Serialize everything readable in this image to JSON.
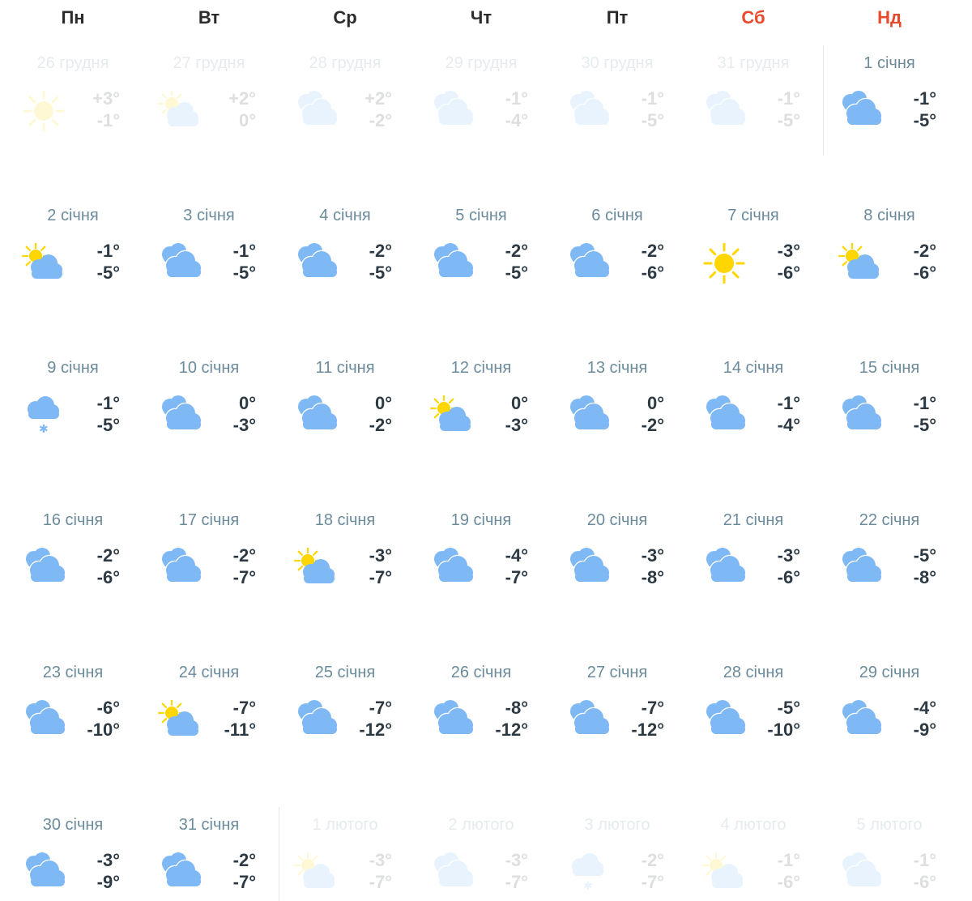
{
  "weekdays": [
    {
      "label": "Пн",
      "weekend": false
    },
    {
      "label": "Вт",
      "weekend": false
    },
    {
      "label": "Ср",
      "weekend": false
    },
    {
      "label": "Чт",
      "weekend": false
    },
    {
      "label": "Пт",
      "weekend": false
    },
    {
      "label": "Сб",
      "weekend": true
    },
    {
      "label": "Нд",
      "weekend": true
    }
  ],
  "colors": {
    "weekend": "#e8492d",
    "cloud": "#7eb8f5",
    "sun": "#ffd600",
    "date": "#6b8b9c",
    "temp": "#2d3a44"
  },
  "weeks": [
    [
      {
        "date": "26 грудня",
        "high": "+3°",
        "low": "-1°",
        "icon": "sun-icon",
        "faded": true
      },
      {
        "date": "27 грудня",
        "high": "+2°",
        "low": "0°",
        "icon": "partly-cloudy-icon",
        "faded": true
      },
      {
        "date": "28 грудня",
        "high": "+2°",
        "low": "-2°",
        "icon": "cloudy-icon",
        "faded": true
      },
      {
        "date": "29 грудня",
        "high": "-1°",
        "low": "-4°",
        "icon": "cloudy-icon",
        "faded": true
      },
      {
        "date": "30 грудня",
        "high": "-1°",
        "low": "-5°",
        "icon": "cloudy-icon",
        "faded": true
      },
      {
        "date": "31 грудня",
        "high": "-1°",
        "low": "-5°",
        "icon": "cloudy-icon",
        "faded": true
      },
      {
        "date": "1 січня",
        "high": "-1°",
        "low": "-5°",
        "icon": "cloudy-icon",
        "faded": false
      }
    ],
    [
      {
        "date": "2 січня",
        "high": "-1°",
        "low": "-5°",
        "icon": "partly-cloudy-icon",
        "faded": false
      },
      {
        "date": "3 січня",
        "high": "-1°",
        "low": "-5°",
        "icon": "cloudy-icon",
        "faded": false
      },
      {
        "date": "4 січня",
        "high": "-2°",
        "low": "-5°",
        "icon": "cloudy-icon",
        "faded": false
      },
      {
        "date": "5 січня",
        "high": "-2°",
        "low": "-5°",
        "icon": "cloudy-icon",
        "faded": false
      },
      {
        "date": "6 січня",
        "high": "-2°",
        "low": "-6°",
        "icon": "cloudy-icon",
        "faded": false
      },
      {
        "date": "7 січня",
        "high": "-3°",
        "low": "-6°",
        "icon": "sun-icon",
        "faded": false
      },
      {
        "date": "8 січня",
        "high": "-2°",
        "low": "-6°",
        "icon": "partly-cloudy-icon",
        "faded": false
      }
    ],
    [
      {
        "date": "9 січня",
        "high": "-1°",
        "low": "-5°",
        "icon": "snow-icon",
        "faded": false
      },
      {
        "date": "10 січня",
        "high": "0°",
        "low": "-3°",
        "icon": "cloudy-icon",
        "faded": false
      },
      {
        "date": "11 січня",
        "high": "0°",
        "low": "-2°",
        "icon": "cloudy-icon",
        "faded": false
      },
      {
        "date": "12 січня",
        "high": "0°",
        "low": "-3°",
        "icon": "partly-cloudy-icon",
        "faded": false
      },
      {
        "date": "13 січня",
        "high": "0°",
        "low": "-2°",
        "icon": "cloudy-icon",
        "faded": false
      },
      {
        "date": "14 січня",
        "high": "-1°",
        "low": "-4°",
        "icon": "cloudy-icon",
        "faded": false
      },
      {
        "date": "15 січня",
        "high": "-1°",
        "low": "-5°",
        "icon": "cloudy-icon",
        "faded": false
      }
    ],
    [
      {
        "date": "16 січня",
        "high": "-2°",
        "low": "-6°",
        "icon": "cloudy-icon",
        "faded": false
      },
      {
        "date": "17 січня",
        "high": "-2°",
        "low": "-7°",
        "icon": "cloudy-icon",
        "faded": false
      },
      {
        "date": "18 січня",
        "high": "-3°",
        "low": "-7°",
        "icon": "partly-cloudy-icon",
        "faded": false
      },
      {
        "date": "19 січня",
        "high": "-4°",
        "low": "-7°",
        "icon": "cloudy-icon",
        "faded": false
      },
      {
        "date": "20 січня",
        "high": "-3°",
        "low": "-8°",
        "icon": "cloudy-icon",
        "faded": false
      },
      {
        "date": "21 січня",
        "high": "-3°",
        "low": "-6°",
        "icon": "cloudy-icon",
        "faded": false
      },
      {
        "date": "22 січня",
        "high": "-5°",
        "low": "-8°",
        "icon": "cloudy-icon",
        "faded": false
      }
    ],
    [
      {
        "date": "23 січня",
        "high": "-6°",
        "low": "-10°",
        "icon": "cloudy-icon",
        "faded": false
      },
      {
        "date": "24 січня",
        "high": "-7°",
        "low": "-11°",
        "icon": "partly-cloudy-icon",
        "faded": false
      },
      {
        "date": "25 січня",
        "high": "-7°",
        "low": "-12°",
        "icon": "cloudy-icon",
        "faded": false
      },
      {
        "date": "26 січня",
        "high": "-8°",
        "low": "-12°",
        "icon": "cloudy-icon",
        "faded": false
      },
      {
        "date": "27 січня",
        "high": "-7°",
        "low": "-12°",
        "icon": "cloudy-icon",
        "faded": false
      },
      {
        "date": "28 січня",
        "high": "-5°",
        "low": "-10°",
        "icon": "cloudy-icon",
        "faded": false
      },
      {
        "date": "29 січня",
        "high": "-4°",
        "low": "-9°",
        "icon": "cloudy-icon",
        "faded": false
      }
    ],
    [
      {
        "date": "30 січня",
        "high": "-3°",
        "low": "-9°",
        "icon": "cloudy-icon",
        "faded": false
      },
      {
        "date": "31 січня",
        "high": "-2°",
        "low": "-7°",
        "icon": "cloudy-icon",
        "faded": false
      },
      {
        "date": "1 лютого",
        "high": "-3°",
        "low": "-7°",
        "icon": "partly-cloudy-icon",
        "faded": true
      },
      {
        "date": "2 лютого",
        "high": "-3°",
        "low": "-7°",
        "icon": "cloudy-icon",
        "faded": true
      },
      {
        "date": "3 лютого",
        "high": "-2°",
        "low": "-7°",
        "icon": "snow-icon",
        "faded": true
      },
      {
        "date": "4 лютого",
        "high": "-1°",
        "low": "-6°",
        "icon": "partly-cloudy-icon",
        "faded": true
      },
      {
        "date": "5 лютого",
        "high": "-1°",
        "low": "-6°",
        "icon": "cloudy-icon",
        "faded": true
      }
    ]
  ]
}
